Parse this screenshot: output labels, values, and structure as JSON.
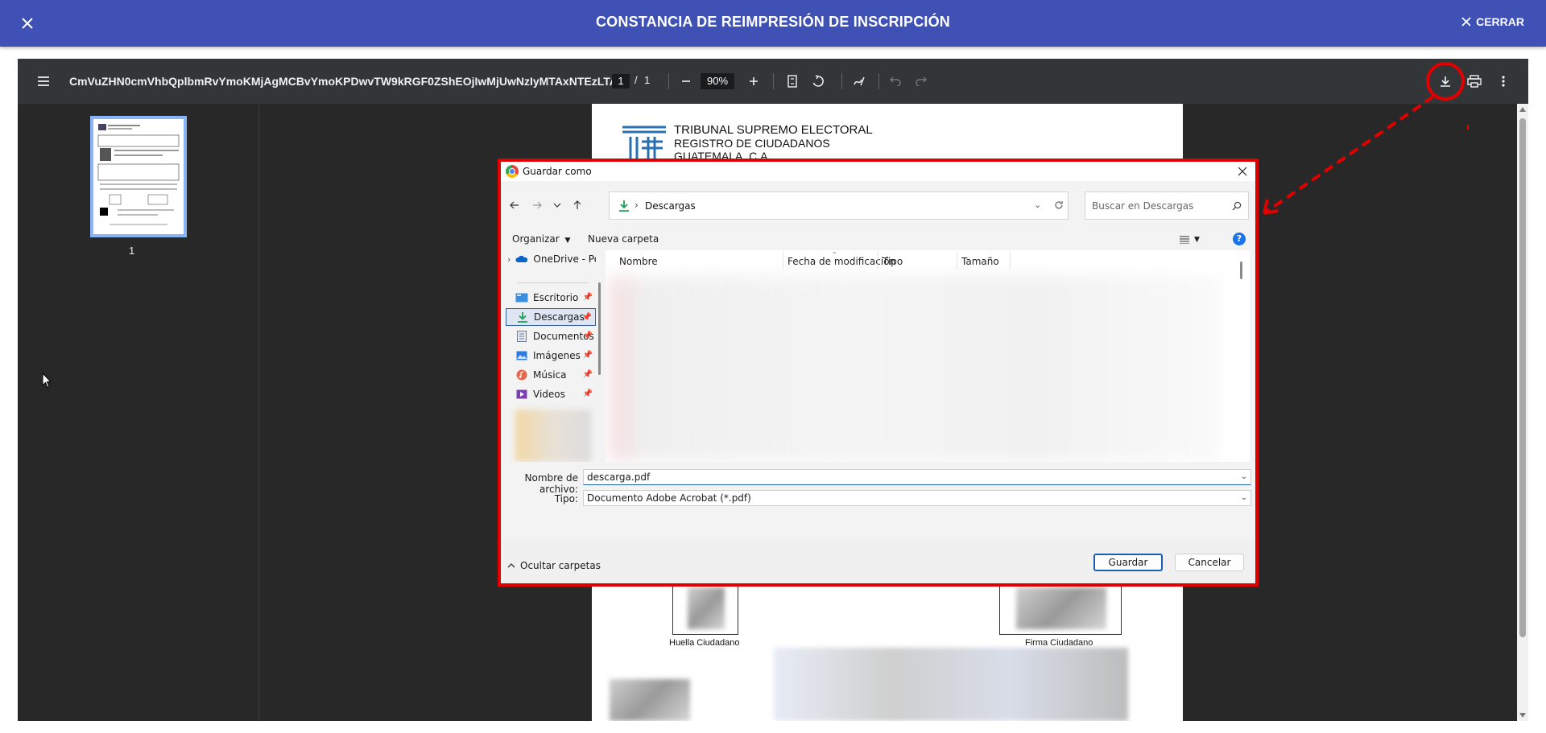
{
  "header": {
    "title": "CONSTANCIA DE REIMPRESIÓN DE INSCRIPCIÓN",
    "close_label": "CERRAR"
  },
  "pdf_viewer": {
    "file_name": "CmVuZHN0cmVhbQplbmRvYmoKMjAgMCBvYmoKPDwvTW9kRGF0ZShEOjIwMjUwNzIyMTAxNTEzLTA...",
    "current_page": "1",
    "page_separator": "/",
    "total_pages": "1",
    "zoom": "90%",
    "thumbnail_label": "1",
    "document": {
      "org_line1": "TRIBUNAL SUPREMO ELECTORAL",
      "org_line2": "REGISTRO DE CIUDADANOS",
      "org_line3": "GUATEMALA, C.A.",
      "fingerprint_label": "Huella Ciudadano",
      "signature_label": "Firma Ciudadano"
    }
  },
  "save_dialog": {
    "title": "Guardar como",
    "location": "Descargas",
    "search_placeholder": "Buscar en Descargas",
    "organize_label": "Organizar",
    "new_folder_label": "Nueva carpeta",
    "help_label": "?",
    "nav_items": [
      {
        "label": "OneDrive - Persor",
        "icon": "onedrive-icon",
        "pinned": false
      },
      {
        "label": "Escritorio",
        "icon": "desktop-icon",
        "pinned": true
      },
      {
        "label": "Descargas",
        "icon": "download-icon",
        "pinned": true,
        "selected": true
      },
      {
        "label": "Documentos",
        "icon": "documents-icon",
        "pinned": true
      },
      {
        "label": "Imágenes",
        "icon": "pictures-icon",
        "pinned": true
      },
      {
        "label": "Música",
        "icon": "music-icon",
        "pinned": true
      },
      {
        "label": "Videos",
        "icon": "videos-icon",
        "pinned": true
      }
    ],
    "columns": [
      "Nombre",
      "Fecha de modificación",
      "Tipo",
      "Tamaño"
    ],
    "filename_label": "Nombre de archivo:",
    "filename_value": "descarga.pdf",
    "type_label": "Tipo:",
    "type_value": "Documento Adobe Acrobat (*.pdf)",
    "hide_folders_label": "Ocultar carpetas",
    "save_button": "Guardar",
    "cancel_button": "Cancelar"
  },
  "colors": {
    "header_blue": "#3f51b5",
    "viewer_toolbar": "#323639",
    "viewer_bg": "#282828",
    "highlight_red": "#e00000",
    "dialog_bg": "#f3f3f3",
    "accent_blue": "#1a5fb4"
  }
}
